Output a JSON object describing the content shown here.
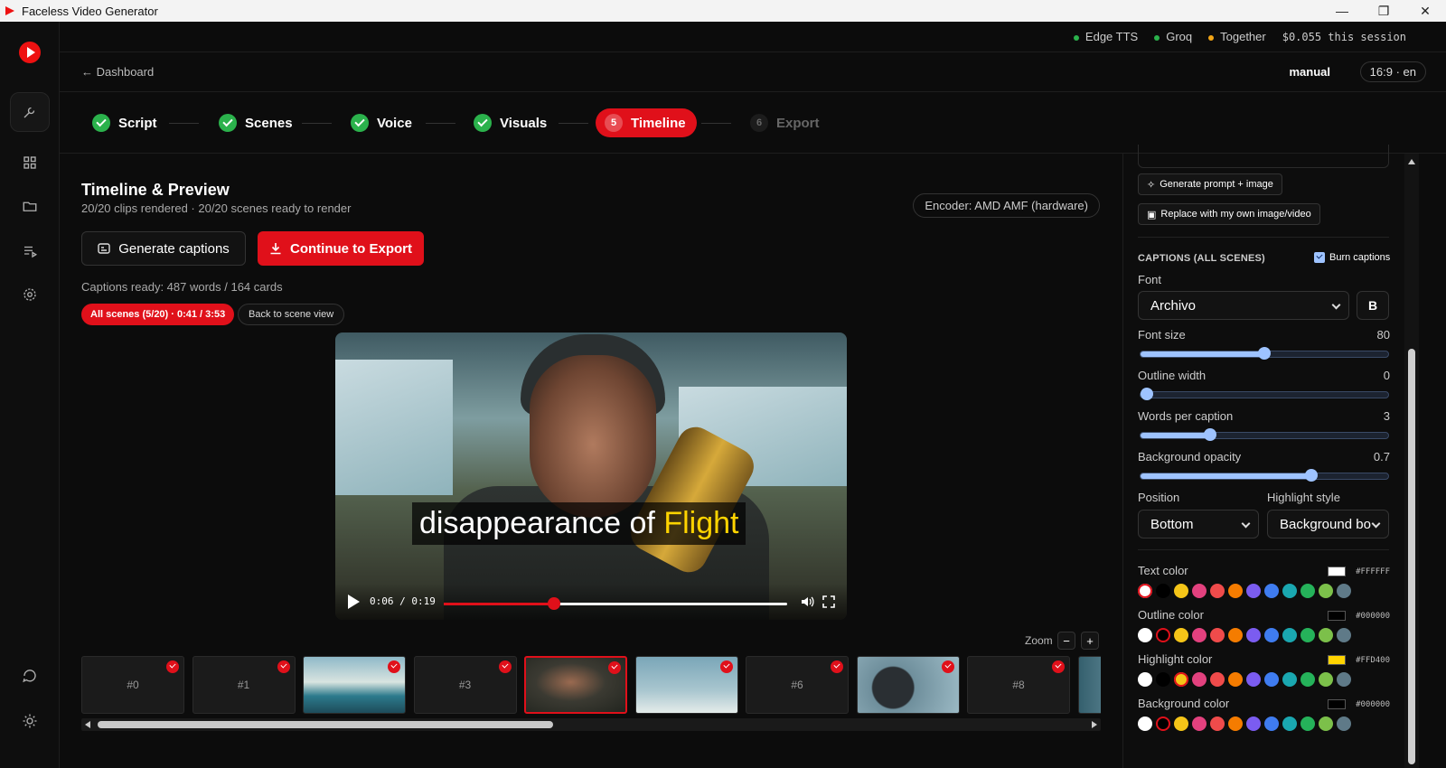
{
  "window": {
    "title": "Faceless Video Generator",
    "controls": [
      "—",
      "❐",
      "✕"
    ]
  },
  "status": {
    "providers": [
      {
        "name": "Edge TTS",
        "color": "#2bb24c"
      },
      {
        "name": "Groq",
        "color": "#2bb24c"
      },
      {
        "name": "Together",
        "color": "#f2a516"
      }
    ],
    "cost": "$0.055 this session"
  },
  "header": {
    "back": "← Dashboard",
    "mode": "manual",
    "aspect": "16:9 · en"
  },
  "steps": [
    {
      "label": "Script",
      "state": "done"
    },
    {
      "label": "Scenes",
      "state": "done"
    },
    {
      "label": "Voice",
      "state": "done"
    },
    {
      "label": "Visuals",
      "state": "done"
    },
    {
      "label": "Timeline",
      "number": "5",
      "state": "active"
    },
    {
      "label": "Export",
      "number": "6",
      "state": "pending"
    }
  ],
  "main": {
    "title": "Timeline & Preview",
    "subtitle": "20/20 clips rendered · 20/20 scenes ready to render",
    "encoder": "Encoder: AMD AMF (hardware)",
    "generate_captions": "Generate captions",
    "continue_export": "Continue to Export",
    "captions_info": "Captions ready: 487 words / 164 cards",
    "all_scenes_pill": "All scenes (5/20) · 0:41 / 3:53",
    "back_scene_view": "Back to scene view"
  },
  "video": {
    "caption_plain": "disappearance of ",
    "caption_highlight": "Flight",
    "time": "0:06 / 0:19",
    "progress": 0.32
  },
  "timeline": {
    "zoom_label": "Zoom",
    "zoom_out": "−",
    "zoom_in": "+",
    "clips": [
      {
        "label": "#0",
        "type": "empty"
      },
      {
        "label": "#1",
        "type": "empty"
      },
      {
        "label": "",
        "type": "beach"
      },
      {
        "label": "#3",
        "type": "empty"
      },
      {
        "label": "",
        "type": "pilot",
        "selected": true
      },
      {
        "label": "",
        "type": "planes"
      },
      {
        "label": "#6",
        "type": "empty"
      },
      {
        "label": "",
        "type": "wheel"
      },
      {
        "label": "#8",
        "type": "empty"
      },
      {
        "label": "",
        "type": "partial"
      }
    ]
  },
  "panel": {
    "gen_prompt": "Generate prompt + image",
    "replace": "Replace with my own image/video",
    "captions_title": "CAPTIONS (ALL SCENES)",
    "burn": "Burn captions",
    "font_label": "Font",
    "font_value": "Archivo",
    "bold": "B",
    "sliders": [
      {
        "label": "Font size",
        "value": "80",
        "fraction": 0.5
      },
      {
        "label": "Outline width",
        "value": "0",
        "fraction": 0.0
      },
      {
        "label": "Words per caption",
        "value": "3",
        "fraction": 0.27
      },
      {
        "label": "Background opacity",
        "value": "0.7",
        "fraction": 0.7
      }
    ],
    "position_label": "Position",
    "position_value": "Bottom",
    "highlight_label": "Highlight style",
    "highlight_value": "Background bo",
    "colors": [
      {
        "label": "Text color",
        "hex": "#FFFFFF",
        "selected": 0
      },
      {
        "label": "Outline color",
        "hex": "#000000",
        "selected": 1
      },
      {
        "label": "Highlight color",
        "hex": "#FFD400",
        "selected": 2
      },
      {
        "label": "Background color",
        "hex": "#000000",
        "selected": 1
      }
    ],
    "palette": [
      "#ffffff",
      "#000000",
      "#f5c518",
      "#e2417e",
      "#ef4b4b",
      "#f57c00",
      "#7b5cf0",
      "#3f7cf0",
      "#1aa7b0",
      "#25b25a",
      "#7cc04a",
      "#5f7a88"
    ]
  }
}
